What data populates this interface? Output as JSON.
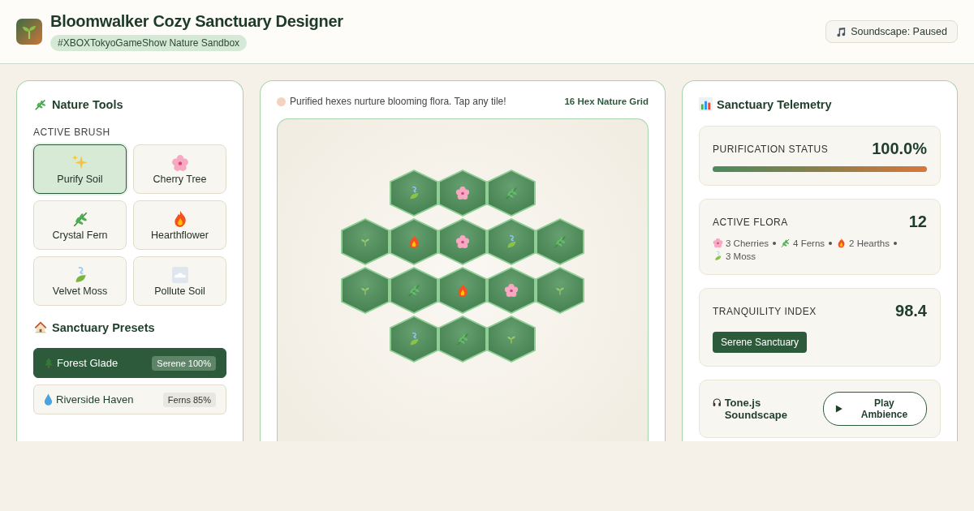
{
  "header": {
    "title": "Bloomwalker Cozy Sanctuary Designer",
    "tag": "#XBOXTokyoGameShow Nature Sandbox",
    "sound_status": "Soundscape: Paused"
  },
  "tools": {
    "title": "Nature Tools",
    "brush_label": "ACTIVE BRUSH",
    "brushes": [
      {
        "label": "Purify Soil",
        "kind": "sparkle",
        "selected": true
      },
      {
        "label": "Cherry Tree",
        "kind": "cherry",
        "selected": false
      },
      {
        "label": "Crystal Fern",
        "kind": "fern",
        "selected": false
      },
      {
        "label": "Hearthflower",
        "kind": "fire",
        "selected": false
      },
      {
        "label": "Velvet Moss",
        "kind": "moss",
        "selected": false
      },
      {
        "label": "Pollute Soil",
        "kind": "cloud",
        "selected": false
      }
    ],
    "presets_title": "Sanctuary Presets",
    "presets": [
      {
        "label": "Forest Glade",
        "kind": "tree",
        "badge": "Serene 100%",
        "selected": true
      },
      {
        "label": "Riverside Haven",
        "kind": "drop",
        "badge": "Ferns 85%",
        "selected": false
      }
    ]
  },
  "grid": {
    "hint": "Purified hexes nurture blooming flora. Tap any tile!",
    "label": "16 Hex Nature Grid",
    "rows": [
      [
        {
          "kind": "moss"
        },
        {
          "kind": "cherry"
        },
        {
          "kind": "fern"
        }
      ],
      [
        {
          "kind": "sprout"
        },
        {
          "kind": "fire"
        },
        {
          "kind": "cherry"
        },
        {
          "kind": "moss"
        },
        {
          "kind": "fern"
        }
      ],
      [
        {
          "kind": "sprout"
        },
        {
          "kind": "fern"
        },
        {
          "kind": "fire"
        },
        {
          "kind": "cherry"
        },
        {
          "kind": "sprout"
        }
      ],
      [
        {
          "kind": "moss"
        },
        {
          "kind": "fern"
        },
        {
          "kind": "sprout"
        }
      ]
    ]
  },
  "telemetry": {
    "title": "Sanctuary Telemetry",
    "purification": {
      "label": "PURIFICATION STATUS",
      "value": "100.0%",
      "level": 1.0
    },
    "flora": {
      "label": "ACTIVE FLORA",
      "value": "12",
      "items": [
        {
          "kind": "cherry",
          "text": "3 Cherries"
        },
        {
          "kind": "fern",
          "text": "4 Ferns"
        },
        {
          "kind": "fire",
          "text": "2 Hearths"
        },
        {
          "kind": "moss",
          "text": "3 Moss"
        }
      ]
    },
    "tranquility": {
      "label": "TRANQUILITY INDEX",
      "value": "98.4",
      "badge": "Serene Sanctuary"
    },
    "sound": {
      "title": "Tone.js Soundscape",
      "button": "Play Ambience"
    }
  }
}
